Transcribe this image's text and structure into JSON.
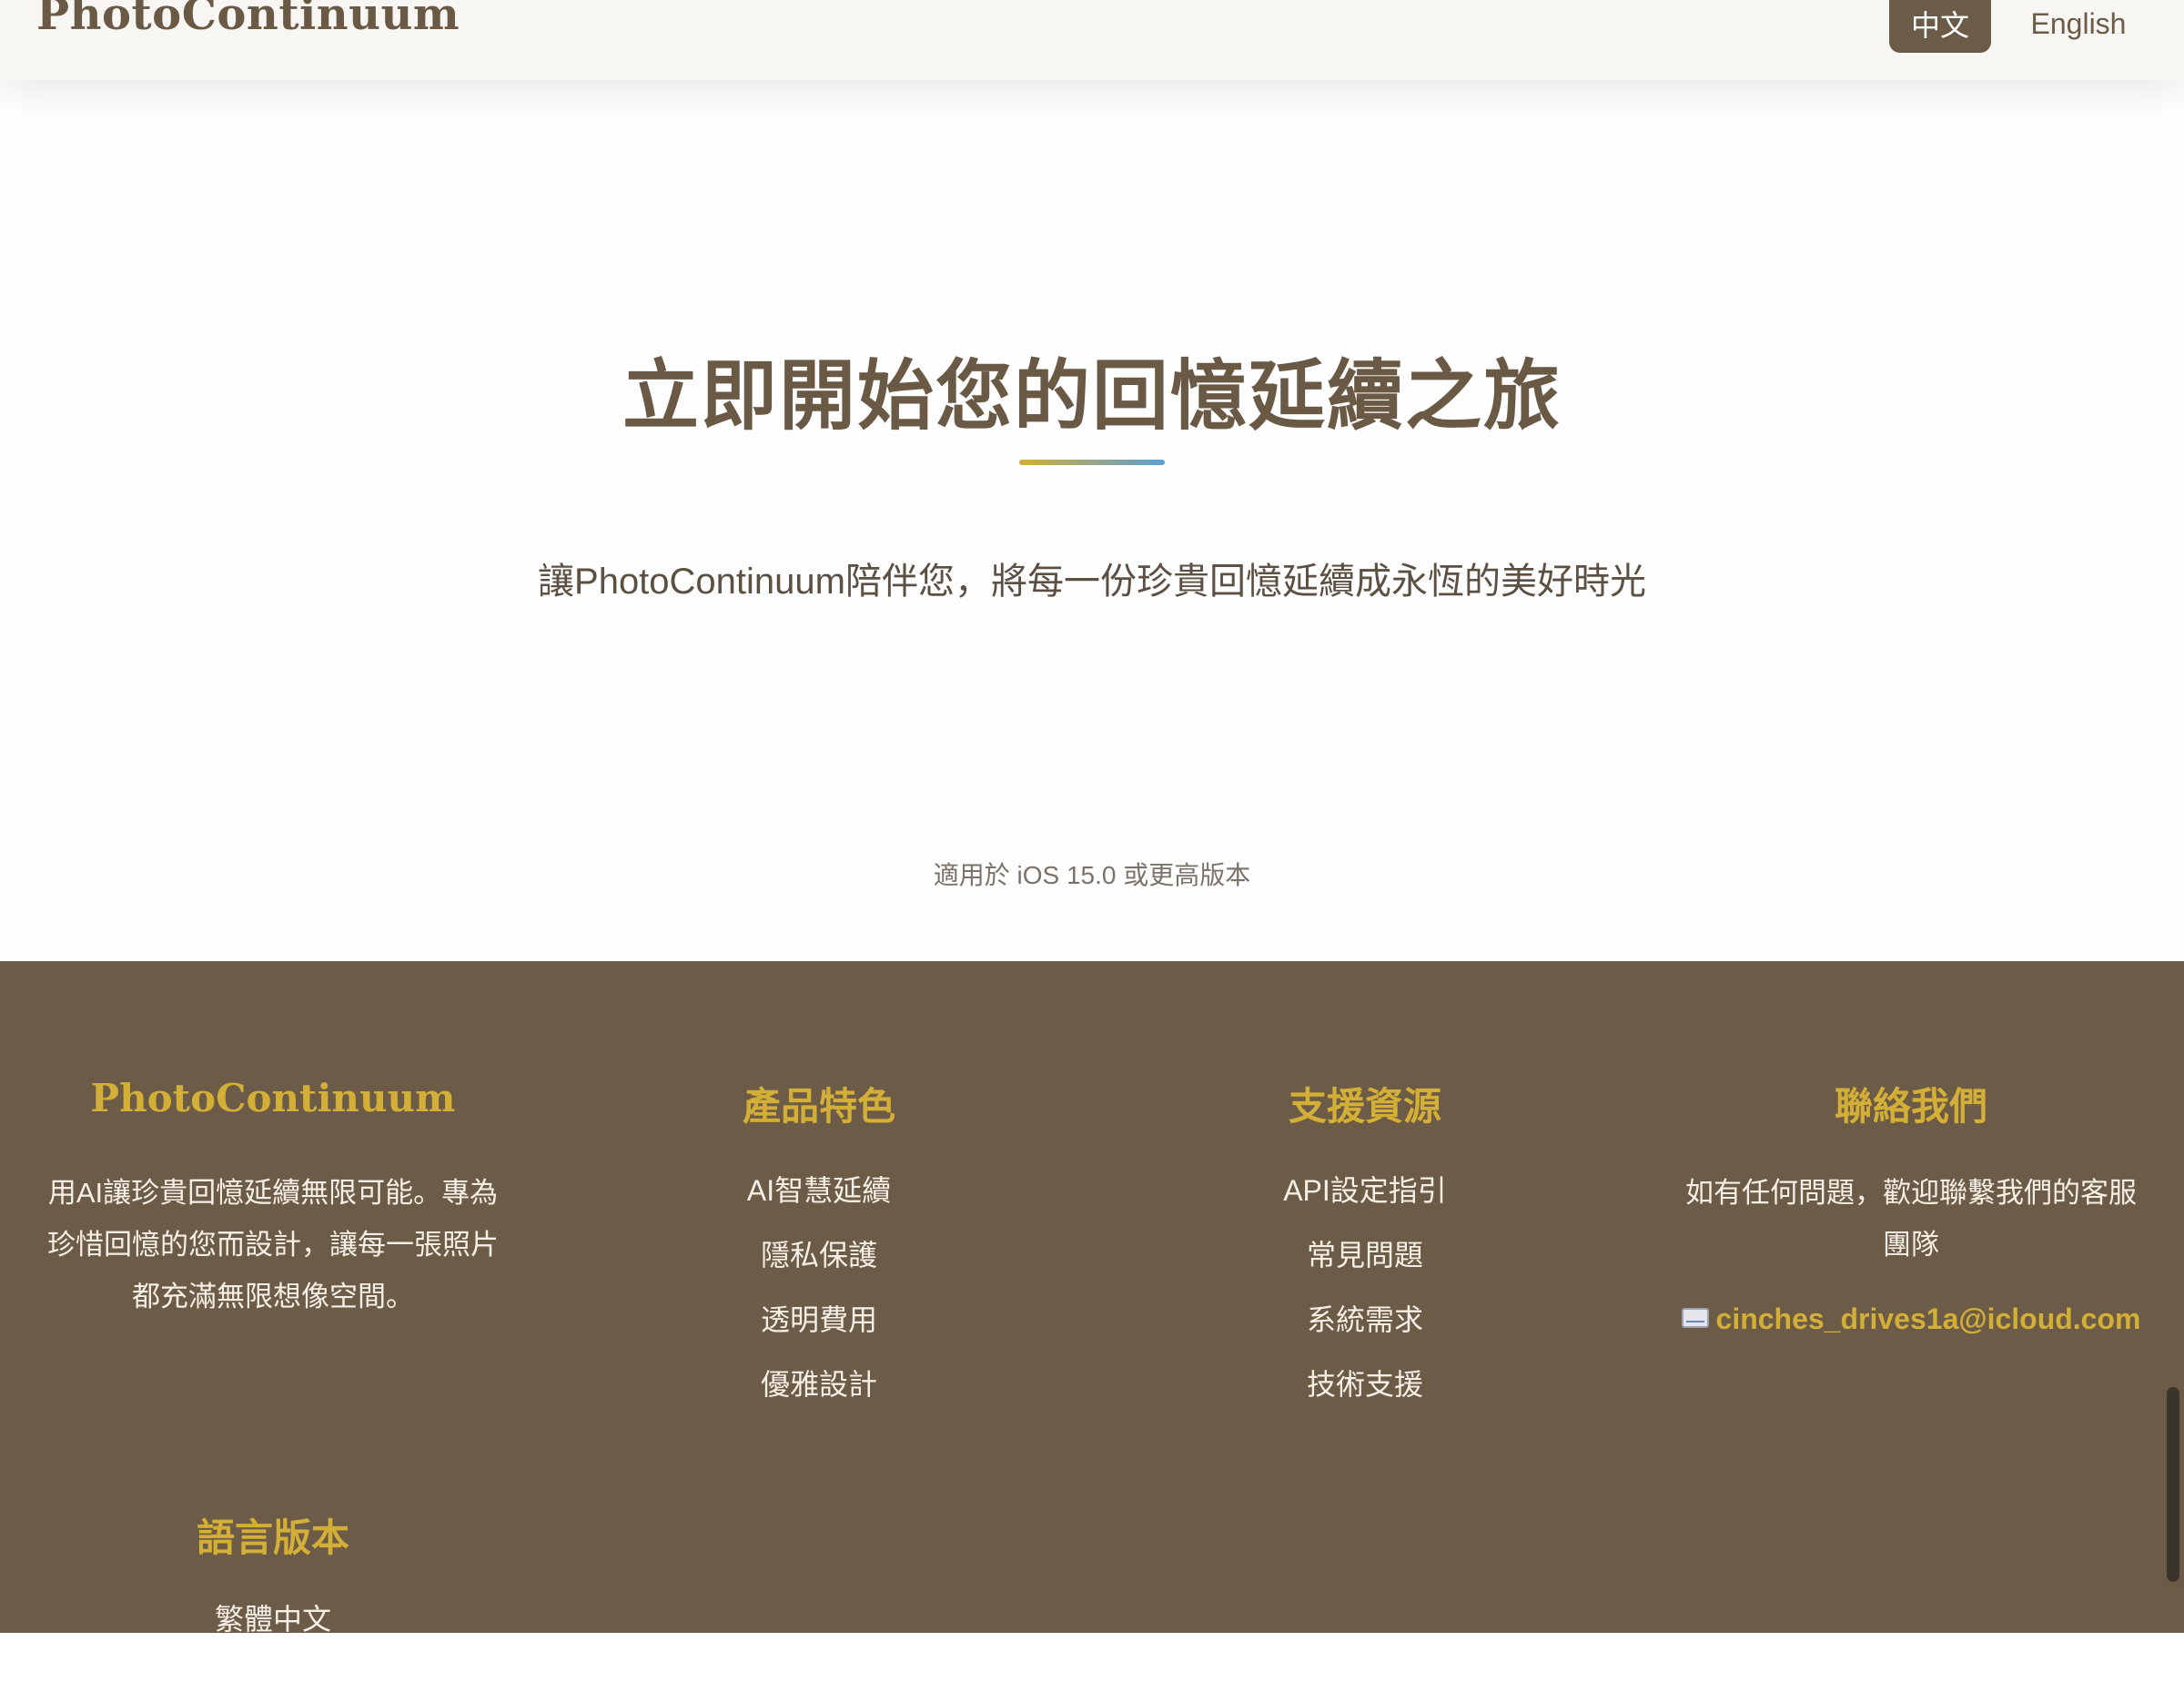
{
  "header": {
    "brand": "PhotoContinuum",
    "lang_zh": "中文",
    "lang_en": "English"
  },
  "hero": {
    "title": "立即開始您的回憶延續之旅",
    "subtitle": "讓PhotoContinuum陪伴您，將每一份珍貴回憶延續成永恆的美好時光",
    "note": "適用於 iOS 15.0 或更高版本"
  },
  "footer": {
    "about": {
      "heading": "PhotoContinuum",
      "text": "用AI讓珍貴回憶延續無限可能。專為珍惜回憶的您而設計，讓每一張照片都充滿無限想像空間。"
    },
    "features": {
      "heading": "產品特色",
      "links": [
        "AI智慧延續",
        "隱私保護",
        "透明費用",
        "優雅設計"
      ]
    },
    "support": {
      "heading": "支援資源",
      "links": [
        "API設定指引",
        "常見問題",
        "系統需求",
        "技術支援"
      ]
    },
    "contact": {
      "heading": "聯絡我們",
      "text": "如有任何問題，歡迎聯繫我們的客服團隊",
      "email": "cinches_drives1a@icloud.com",
      "email_icon": "mail-icon"
    },
    "language": {
      "heading": "語言版本",
      "links": [
        "繁體中文"
      ]
    }
  },
  "colors": {
    "brown": "#6b5b47",
    "gold": "#d4af37",
    "blue": "#5a9fd4",
    "header_bg": "#f7f6f3"
  }
}
